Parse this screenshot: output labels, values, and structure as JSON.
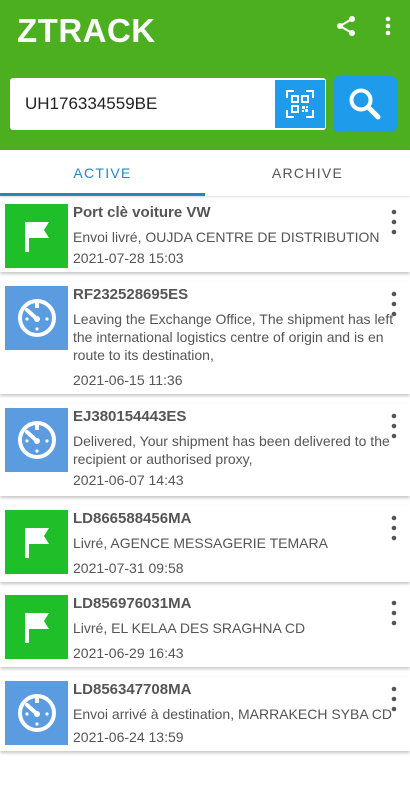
{
  "app": {
    "title": "ZTRACK",
    "share_icon": "share-icon",
    "menu_icon": "more-vert-icon"
  },
  "search": {
    "value": "UH176334559BE",
    "scan_icon": "qr-scan-icon",
    "search_icon": "search-icon"
  },
  "tabs": [
    {
      "label": "ACTIVE",
      "selected": true
    },
    {
      "label": "ARCHIVE",
      "selected": false
    }
  ],
  "colors": {
    "appbar": "#4caf1f",
    "accent": "#1e9bea",
    "delivered": "#1fbf2a",
    "in_transit": "#5b9be0"
  },
  "shipments": [
    {
      "title": "Port clè voiture VW",
      "description": "Envoi livré, OUJDA CENTRE DE DISTRIBUTION",
      "date": "2021-07-28 15:03",
      "status_icon": "flag-icon"
    },
    {
      "title": "RF232528695ES",
      "description": "Leaving the Exchange Office, The shipment has left the international logistics centre of origin and is en route to its destination,",
      "date": "2021-06-15 11:36",
      "status_icon": "timer-icon"
    },
    {
      "title": "EJ380154443ES",
      "description": "Delivered, Your shipment has been delivered to the recipient or authorised proxy,",
      "date": "2021-06-07 14:43",
      "status_icon": "timer-icon"
    },
    {
      "title": "LD866588456MA",
      "description": "Livré, AGENCE MESSAGERIE TEMARA",
      "date": "2021-07-31 09:58",
      "status_icon": "flag-icon"
    },
    {
      "title": "LD856976031MA",
      "description": "Livré, EL KELAA DES SRAGHNA CD",
      "date": "2021-06-29 16:43",
      "status_icon": "flag-icon"
    },
    {
      "title": "LD856347708MA",
      "description": "Envoi arrivé à destination, MARRAKECH SYBA CD",
      "date": "2021-06-24 13:59",
      "status_icon": "timer-icon"
    }
  ]
}
